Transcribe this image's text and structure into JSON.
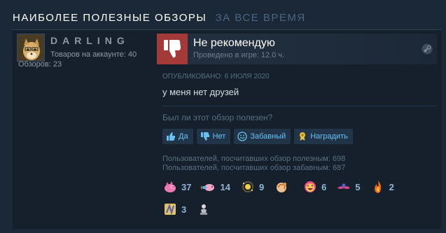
{
  "section": {
    "title": "НАИБОЛЕЕ ПОЛЕЗНЫЕ ОБЗОРЫ",
    "subtitle": "ЗА ВСЕ ВРЕМЯ"
  },
  "author": {
    "name": "DARLING",
    "games": "Товаров на аккаунте: 40",
    "reviews": "Обзоров: 23"
  },
  "review": {
    "recommendation": "Не рекомендую",
    "hours": "Проведено в игре: 12.0 ч.",
    "posted": "ОПУБЛИКОВАНО: 6 ИЮЛЯ 2020",
    "text": "у меня нет друзей",
    "helpful_question": "Был ли этот обзор полезен?",
    "buttons": {
      "yes": "Да",
      "no": "Нет",
      "funny": "Забавный",
      "award": "Наградить"
    },
    "stats": {
      "helpful": "Пользователей, посчитавших обзор полезным: 698",
      "funny": "Пользователей, посчитавших обзор забавным: 687"
    },
    "awards": [
      {
        "icon": "pig-award-icon",
        "count": "37"
      },
      {
        "icon": "rocket-pig-award-icon",
        "count": "14"
      },
      {
        "icon": "sparkle-award-icon",
        "count": "9"
      },
      {
        "icon": "hand-award-icon",
        "count": ""
      },
      {
        "icon": "laughing-face-award-icon",
        "count": "6"
      },
      {
        "icon": "mustache-award-icon",
        "count": "5"
      },
      {
        "icon": "fire-award-icon",
        "count": "2"
      },
      {
        "icon": "golden-scroll-award-icon",
        "count": "3"
      },
      {
        "icon": "statue-award-icon",
        "count": ""
      }
    ]
  },
  "colors": {
    "background": "#1b2838",
    "panel": "#16202d",
    "negative_thumb": "#a33a38",
    "link_blue": "#67c1f5"
  }
}
